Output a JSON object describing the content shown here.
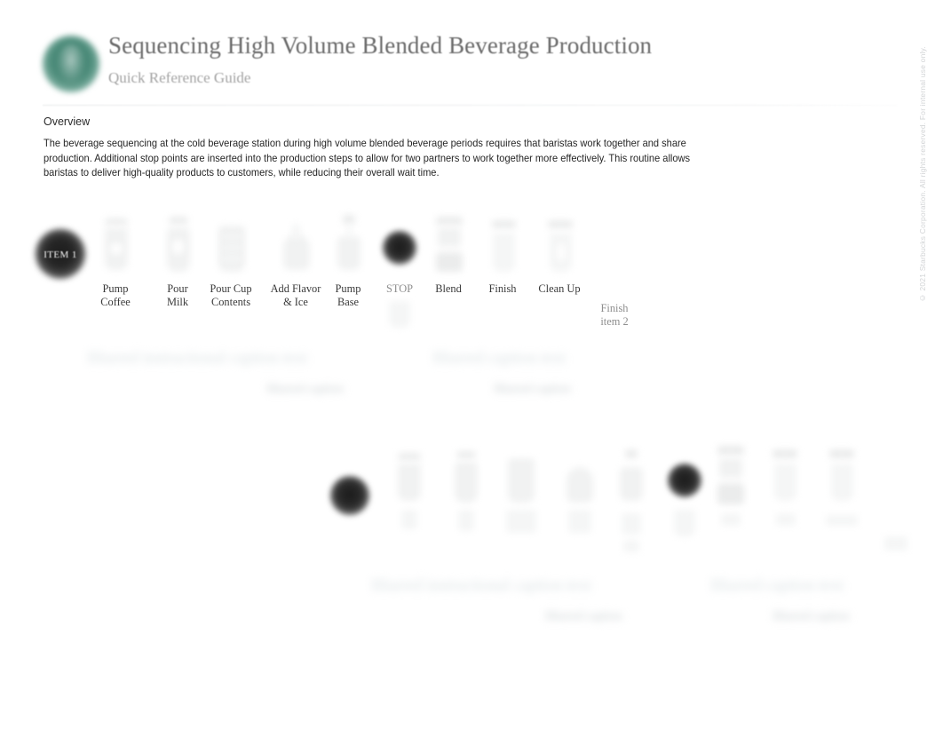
{
  "document": {
    "title": "Sequencing High Volume Blended Beverage Production",
    "subtitle": "Quick Reference Guide",
    "logo_color": "#3f8270",
    "copyright": "© 2021 Starbucks Corporation.  All rights reserved.  For internal use only."
  },
  "overview": {
    "heading": "Overview",
    "body": "The beverage sequencing at the cold beverage station during high volume blended beverage periods requires that baristas work together and share production. Additional stop points are inserted into the production steps to allow for two partners to work together more effectively. This routine allows baristas to deliver high-quality products to customers, while reducing their overall wait time."
  },
  "row1": {
    "badge": "ITEM 1",
    "steps": [
      {
        "label": "Pump\nCoffee",
        "icon": "cup-icon",
        "style": "normal"
      },
      {
        "label": "Pour\nMilk",
        "icon": "pitcher-icon",
        "style": "normal"
      },
      {
        "label": "Pour Cup\nContents",
        "icon": "cup-pour-icon",
        "style": "normal"
      },
      {
        "label": "Add Flavor\n& Ice",
        "icon": "scoop-icon",
        "style": "normal"
      },
      {
        "label": "Pump\nBase",
        "icon": "pump-bottle-icon",
        "style": "normal"
      },
      {
        "label": "STOP",
        "icon": "stop-dot-icon",
        "style": "gray"
      },
      {
        "label": "Blend",
        "icon": "blender-icon",
        "style": "normal"
      },
      {
        "label": "Finish",
        "icon": "finish-cup-icon",
        "style": "normal"
      },
      {
        "label": "Clean Up",
        "icon": "clean-cup-icon",
        "style": "normal"
      }
    ],
    "trailing_note": "Finish\nitem 2",
    "captions": [
      "Blurred instructional caption text",
      "Blurred caption",
      "Blurred caption text",
      "Blurred caption"
    ]
  },
  "row2": {
    "steps": [
      {
        "label": "",
        "icon": "stop-dot-icon"
      },
      {
        "label": "",
        "icon": "cup-icon"
      },
      {
        "label": "",
        "icon": "pitcher-icon"
      },
      {
        "label": "",
        "icon": "cup-pour-icon"
      },
      {
        "label": "",
        "icon": "scoop-icon"
      },
      {
        "label": "",
        "icon": "pump-bottle-icon"
      },
      {
        "label": "",
        "icon": "stop-dot-icon"
      },
      {
        "label": "",
        "icon": "blender-icon"
      },
      {
        "label": "",
        "icon": "finish-cup-icon"
      },
      {
        "label": "",
        "icon": "clean-cup-icon"
      },
      {
        "label": "",
        "icon": "small-note-icon"
      }
    ],
    "captions": [
      "Blurred instructional caption text",
      "Blurred caption",
      "Blurred caption text",
      "Blurred caption"
    ]
  }
}
